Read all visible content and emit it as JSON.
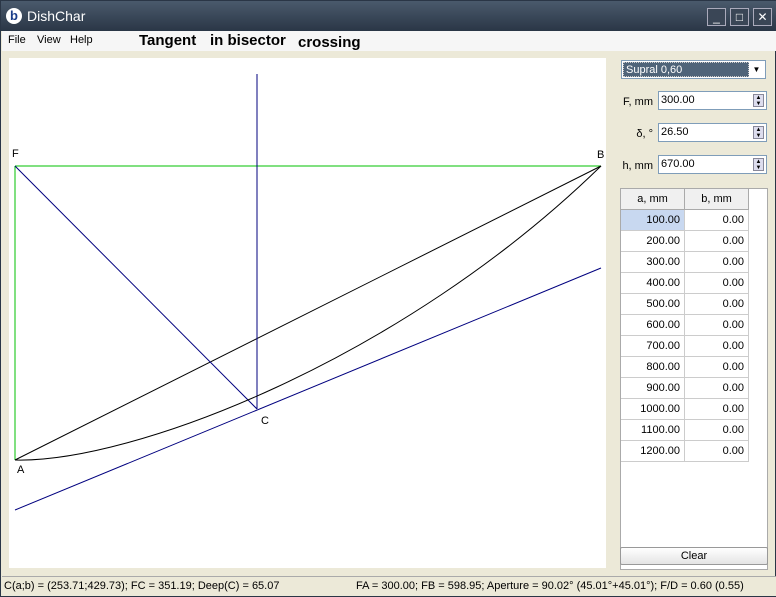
{
  "window": {
    "title": "DishChar"
  },
  "menu": [
    "File",
    "View",
    "Help"
  ],
  "heading": {
    "part1": "Tangent",
    "part2": "in bisector",
    "part3": "crossing"
  },
  "plot": {
    "labels": {
      "F": "F",
      "B": "B",
      "A": "A",
      "C": "C"
    }
  },
  "panel": {
    "profile": "Supral 0,60",
    "fields": [
      {
        "label": "F, mm",
        "value": "300.00"
      },
      {
        "label": "δ, °",
        "value": "26.50"
      },
      {
        "label": "h, mm",
        "value": "670.00"
      }
    ],
    "table": {
      "headers": [
        "a, mm",
        "b, mm"
      ],
      "rows": [
        [
          "100.00",
          "0.00"
        ],
        [
          "200.00",
          "0.00"
        ],
        [
          "300.00",
          "0.00"
        ],
        [
          "400.00",
          "0.00"
        ],
        [
          "500.00",
          "0.00"
        ],
        [
          "600.00",
          "0.00"
        ],
        [
          "700.00",
          "0.00"
        ],
        [
          "800.00",
          "0.00"
        ],
        [
          "900.00",
          "0.00"
        ],
        [
          "1000.00",
          "0.00"
        ],
        [
          "1100.00",
          "0.00"
        ],
        [
          "1200.00",
          "0.00"
        ]
      ]
    },
    "clear": "Clear"
  },
  "status": {
    "left": "C(a;b) = (253.71;429.73); FC = 351.19; Deep(C) = 65.07",
    "right": "FA = 300.00; FB = 598.95; Aperture = 90.02° (45.01°+45.01°); F/D = 0.60 (0.55)"
  },
  "colors": {
    "green": "#00c000",
    "blue": "#00007f",
    "black": "#000000"
  }
}
